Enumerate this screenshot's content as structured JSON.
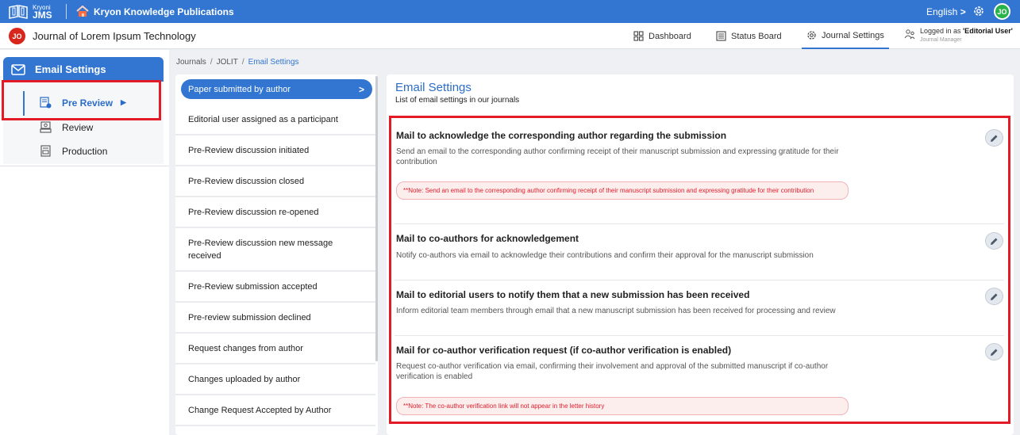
{
  "topbar": {
    "brand_small": "Kryoni",
    "brand_big": "JMS",
    "publisher": "Kryon Knowledge Publications",
    "language": "English",
    "language_chevron": ">",
    "user_initials": "JO"
  },
  "header": {
    "journal_initials": "JO",
    "journal_title": "Journal of Lorem Ipsum Technology",
    "nav": {
      "dashboard": "Dashboard",
      "status_board": "Status Board",
      "journal_settings": "Journal Settings"
    },
    "logged_in_prefix": "Logged in as ",
    "logged_in_user": "'Editorial User'",
    "role": "Journal Manager"
  },
  "sidebar": {
    "title": "Email Settings",
    "items": [
      {
        "label": "Pre Review",
        "active": true,
        "icon": "pre-review-icon"
      },
      {
        "label": "Review",
        "active": false,
        "icon": "review-icon"
      },
      {
        "label": "Production",
        "active": false,
        "icon": "production-icon"
      }
    ],
    "active_chevron": "▶"
  },
  "breadcrumb": [
    "Journals",
    "JOLIT",
    "Email Settings"
  ],
  "breadcrumb_sep": "/",
  "events": [
    "Paper submitted by author",
    "Editorial user assigned as a participant",
    "Pre-Review discussion initiated",
    "Pre-Review discussion closed",
    "Pre-Review discussion re-opened",
    "Pre-Review discussion new message received",
    "Pre-Review submission accepted",
    "Pre-review submission declined",
    "Request changes from author",
    "Changes uploaded by author",
    "Change Request Accepted by Author"
  ],
  "events_active_chevron": ">",
  "main": {
    "title": "Email Settings",
    "subtitle": "List of email settings in our journals",
    "cards": [
      {
        "title": "Mail to acknowledge the corresponding author regarding the submission",
        "desc": "Send an email to the corresponding author confirming receipt of their manuscript submission and expressing gratitude for their contribution",
        "note": "**Note: Send an email to the corresponding author confirming receipt of their manuscript submission and expressing gratitude for their contribution"
      },
      {
        "title": "Mail to co-authors for acknowledgement",
        "desc": "Notify co-authors via email to acknowledge their contributions and confirm their approval for the manuscript submission",
        "note": ""
      },
      {
        "title": "Mail to editorial users to notify them that a new submission has been received",
        "desc": "Inform editorial team members through email that a new manuscript submission has been received for processing and review",
        "note": ""
      },
      {
        "title": "Mail for co-author verification request (if co-author verification is enabled)",
        "desc": "Request co-author verification via email, confirming their involvement and approval of the submitted manuscript if co-author verification is enabled",
        "note": "**Note: The co-author verification link will not appear in the letter history"
      }
    ]
  },
  "colors": {
    "primary": "#3276d2",
    "highlight_red": "#e21b26",
    "avatar_green": "#26b34a",
    "journal_red": "#d9261c"
  }
}
